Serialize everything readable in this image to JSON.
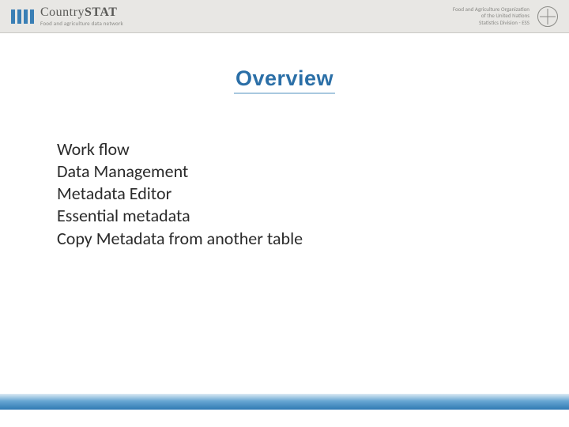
{
  "header": {
    "brand_light": "Country",
    "brand_bold": "STAT",
    "brand_sub": "Food and agriculture data network",
    "org_line1": "Food and Agriculture Organization",
    "org_line2": "of the United Nations",
    "org_line3": "Statistics Division - ESS"
  },
  "title": "Overview",
  "items": [
    "Work flow",
    "Data Management",
    "Metadata Editor",
    "Essential metadata",
    "Copy Metadata from another table"
  ]
}
